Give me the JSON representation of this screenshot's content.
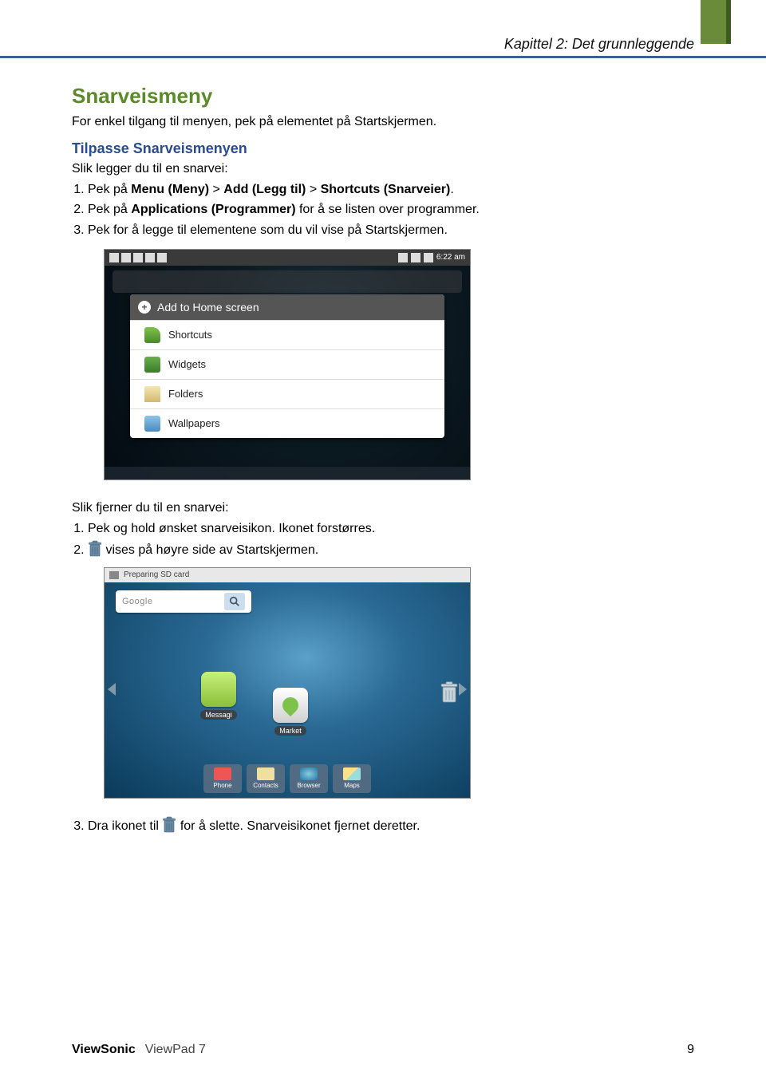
{
  "chapter": "Kapittel 2: Det grunnleggende",
  "h1": "Snarveismeny",
  "p1": "For enkel tilgang til menyen, pek på elementet på Startskjermen.",
  "h2": "Tilpasse Snarveismenyen",
  "intro1": "Slik legger du til en snarvei:",
  "steps1": {
    "s1_a": "Pek på ",
    "s1_b1": "Menu (Meny)",
    "s1_gt1": " > ",
    "s1_b2": "Add (Legg til)",
    "s1_gt2": " > ",
    "s1_b3": "Shortcuts (Snarveier)",
    "s1_end": ".",
    "s2_a": "Pek på ",
    "s2_b": "Applications (Programmer)",
    "s2_end": " for å se listen over programmer.",
    "s3": "Pek for å legge til elementene som du vil vise på Startskjermen."
  },
  "shot1": {
    "status_time": "6:22 am",
    "menu_title": "Add to Home screen",
    "items": [
      "Shortcuts",
      "Widgets",
      "Folders",
      "Wallpapers"
    ]
  },
  "intro2": "Slik fjerner du til en snarvei:",
  "steps2": {
    "s1": "Pek og hold ønsket snarveisikon. Ikonet forstørres.",
    "s2_end": " vises på høyre side av Startskjermen.",
    "s3_a": "Dra ikonet til ",
    "s3_b": " for å slette. Snarveisikonet fjernet deretter."
  },
  "shot2": {
    "sd": "Preparing SD card",
    "search_placeholder": "Google",
    "apps": {
      "messaging": "Messagi",
      "market": "Market"
    },
    "dock": [
      "Phone",
      "Contacts",
      "Browser",
      "Maps"
    ]
  },
  "footer": {
    "brand": "ViewSonic",
    "product": "ViewPad 7",
    "page": "9"
  }
}
